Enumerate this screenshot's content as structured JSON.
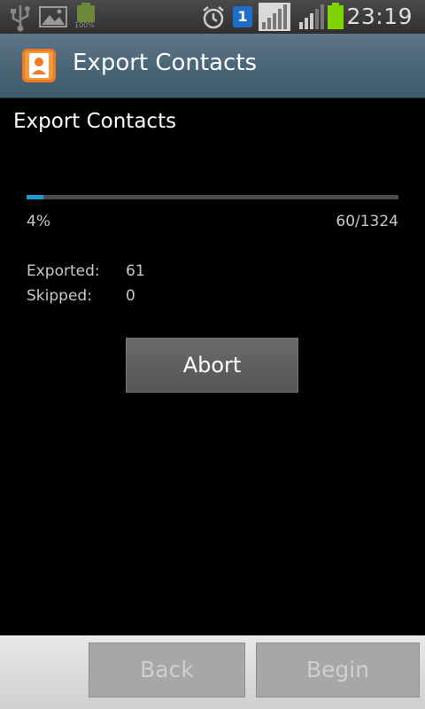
{
  "status_bar": {
    "time": "23:19",
    "battery_text": "100%",
    "sim_badge": "1",
    "icons": [
      "usb-icon",
      "image-icon",
      "battery-full-icon",
      "alarm-icon",
      "sim-icon",
      "signal-icon",
      "signal-icon",
      "battery-charging-icon"
    ]
  },
  "title_bar": {
    "title": "Export Contacts",
    "icon": "contacts-app-icon"
  },
  "content": {
    "heading": "Export Contacts",
    "progress_percent_text": "4%",
    "progress_value": 0.0453,
    "progress_count_text": "60/1324",
    "stats": [
      {
        "label": "Exported:",
        "value": "61"
      },
      {
        "label": "Skipped:",
        "value": "0"
      }
    ],
    "abort_label": "Abort"
  },
  "bottom_bar": {
    "back_label": "Back",
    "begin_label": "Begin"
  },
  "colors": {
    "progress_fill": "#1c9bd6",
    "title_bar": "#4a6478",
    "battery_green": "#6cc600"
  }
}
